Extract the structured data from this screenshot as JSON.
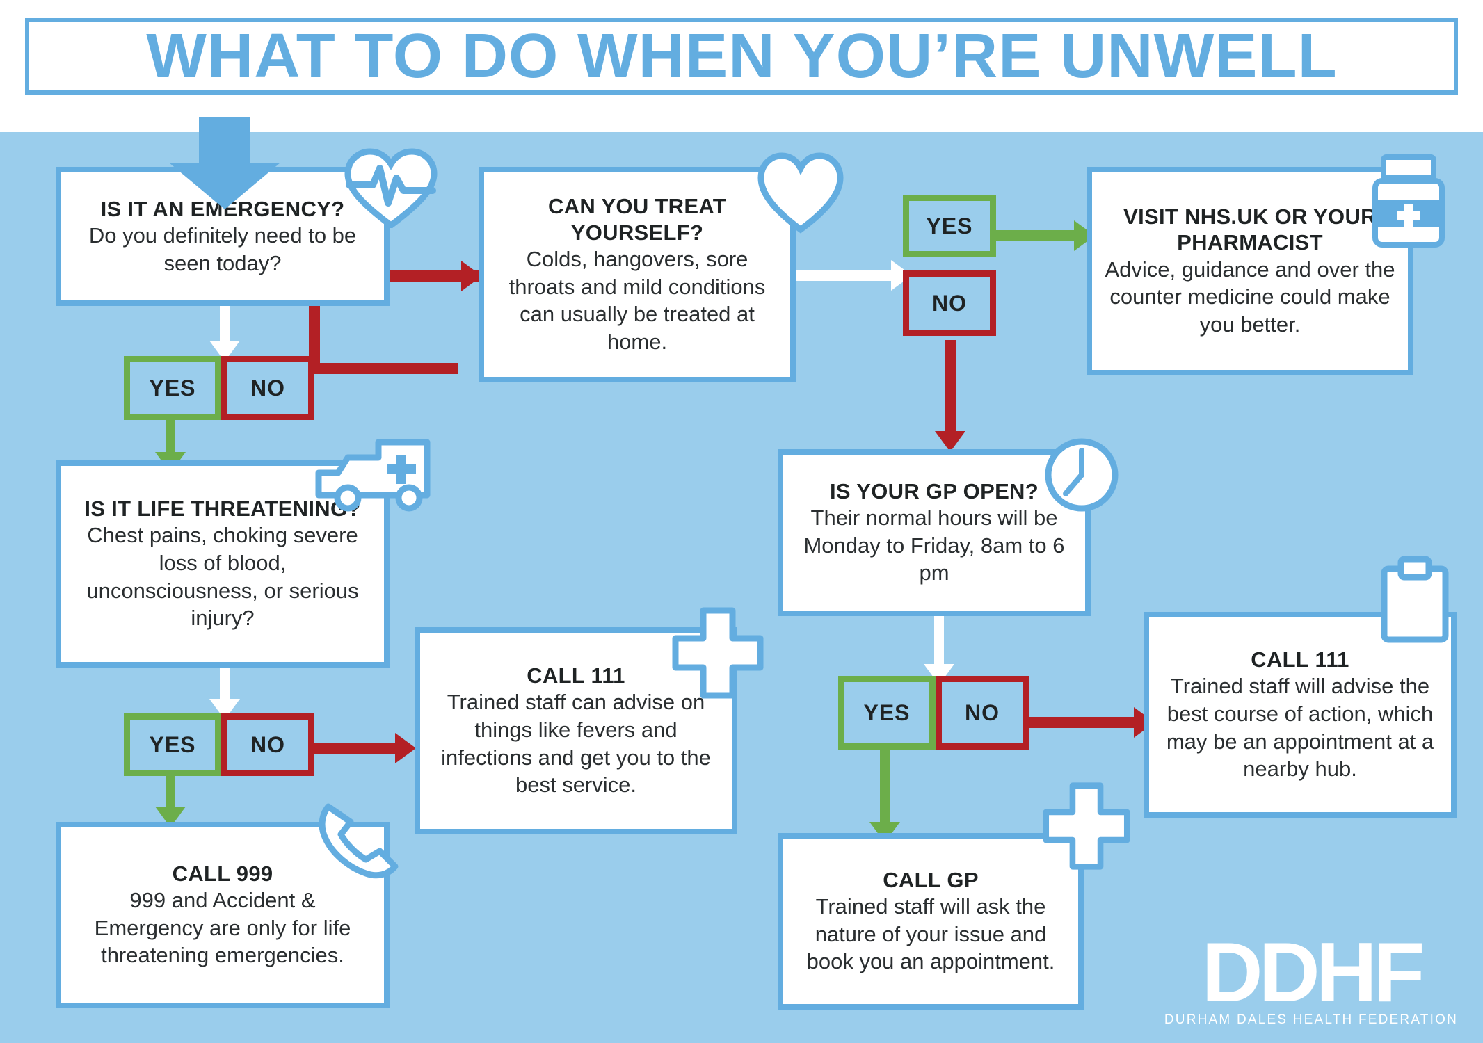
{
  "page": {
    "title": "WHAT TO DO WHEN YOU’RE UNWELL",
    "background_color": "#9ACDEC",
    "accent_blue": "#63ADE0",
    "yes_color": "#6CAE4A",
    "no_color": "#B32025",
    "text_color": "#1F2324"
  },
  "nodes": {
    "emergency": {
      "title": "IS IT AN EMERGENCY?",
      "body": "Do you definitely need to be seen today?",
      "icon": "heartbeat-icon"
    },
    "treat_yourself": {
      "title": "CAN YOU TREAT YOURSELF?",
      "body": "Colds, hangovers, sore throats and mild conditions can usually be treated at home.",
      "icon": "heart-icon"
    },
    "pharmacist": {
      "title": "VISIT NHS.UK OR YOUR PHARMACIST",
      "body": "Advice, guidance and over the counter medicine could make you better.",
      "icon": "medicine-bottle-icon"
    },
    "life_threatening": {
      "title": "IS IT LIFE THREATENING?",
      "body": "Chest pains, choking severe loss of blood, unconsciousness, or serious injury?",
      "icon": "ambulance-icon"
    },
    "gp_open": {
      "title": "IS YOUR GP OPEN?",
      "body": "Their normal hours will be Monday to Friday, 8am to 6 pm",
      "icon": "clock-icon"
    },
    "call_111_left": {
      "title": "CALL 111",
      "body": "Trained staff can advise on things like fevers and infections and get you to the best service.",
      "icon": "medical-cross-icon"
    },
    "call_111_right": {
      "title": "CALL 111",
      "body": "Trained staff will advise the best course of action, which may be an appointment at a nearby hub.",
      "icon": "clipboard-icon"
    },
    "call_999": {
      "title": "CALL 999",
      "body": "999 and Accident & Emergency are only for life threatening emergencies.",
      "icon": "phone-handset-icon"
    },
    "call_gp": {
      "title": "CALL GP",
      "body": "Trained staff will ask the nature of your issue and book you an appointment.",
      "icon": "medical-cross-icon"
    }
  },
  "decisions": {
    "emergency_yes": "YES",
    "emergency_no": "NO",
    "life_threatening_yes": "YES",
    "life_threatening_no": "NO",
    "treat_yourself_yes": "YES",
    "treat_yourself_no": "NO",
    "gp_open_yes": "YES",
    "gp_open_no": "NO"
  },
  "logo": {
    "mark": "DDHF",
    "subtitle": "DURHAM DALES HEALTH FEDERATION"
  }
}
